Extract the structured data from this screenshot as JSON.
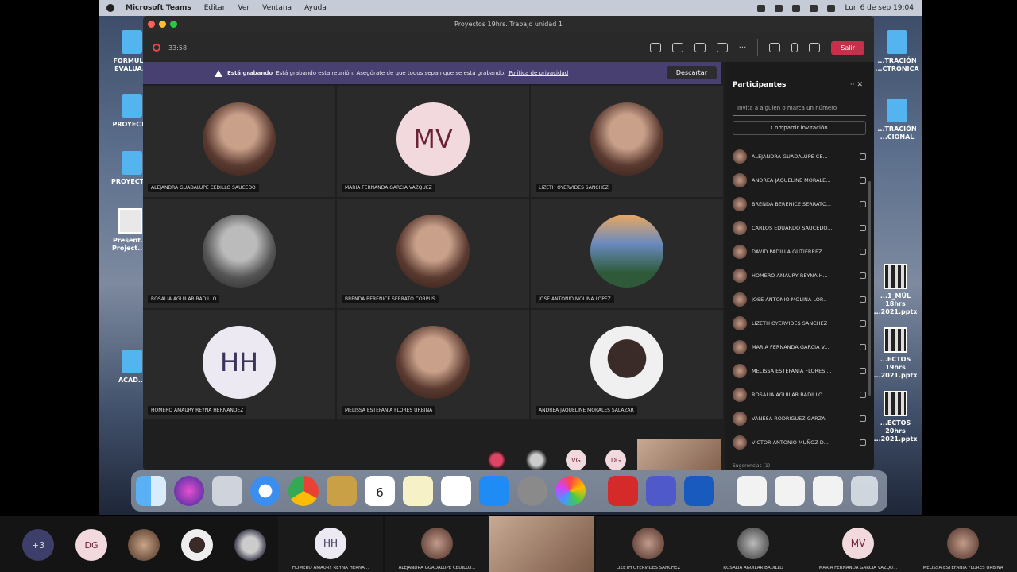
{
  "menubar": {
    "app": "Microsoft Teams",
    "items": [
      "Editar",
      "Ver",
      "Ventana",
      "Ayuda"
    ],
    "clock": "Lun 6 de sep  19:04"
  },
  "desktop_icons": [
    {
      "label": "FORMUL... EVALUA..."
    },
    {
      "label": "PROYECT..."
    },
    {
      "label": "PROYECTI..."
    },
    {
      "label": "Present... Project...s"
    },
    {
      "label": "ACAD..."
    },
    {
      "label": "...TRACIÓN ...CTRÓNICA"
    },
    {
      "label": "...TRACIÓN ...CIONAL"
    },
    {
      "label": "...1_MÜL 18hrs ...2021.pptx"
    },
    {
      "label": "...ECTOS 19hrs ...2021.pptx"
    },
    {
      "label": "...ECTOS 20hrs ...2021.pptx"
    }
  ],
  "window": {
    "title": "Proyectos 19hrs. Trabajo unidad 1"
  },
  "toolbar": {
    "timer": "33:58",
    "leave_label": "Salir"
  },
  "banner": {
    "bold": "Está grabando",
    "text": "Está grabando esta reunión. Asegúrate de que todos sepan que se está grabando.",
    "link": "Política de privacidad",
    "dismiss": "Descartar"
  },
  "tiles": [
    {
      "name": "ALEJANDRA GUADALUPE CEDILLO SAUCEDO",
      "initials": ""
    },
    {
      "name": "MARIA FERNANDA GARCIA VAZQUEZ",
      "initials": "MV"
    },
    {
      "name": "LIZETH OYERVIDES SANCHEZ",
      "initials": ""
    },
    {
      "name": "ROSALIA AGUILAR BADILLO",
      "initials": ""
    },
    {
      "name": "BRENDA BERENICE SERRATO CORPUS",
      "initials": ""
    },
    {
      "name": "JOSE ANTONIO MOLINA LOPEZ",
      "initials": ""
    },
    {
      "name": "HOMERO AMAURY REYNA HERNANDEZ",
      "initials": "HH"
    },
    {
      "name": "MELISSA ESTEFANIA FLORES URBINA",
      "initials": ""
    },
    {
      "name": "ANDREA JAQUELINE MORALES SALAZAR",
      "initials": ""
    }
  ],
  "overflow": {
    "initials_1": "VG",
    "initials_2": "DG"
  },
  "panel": {
    "title": "Participantes",
    "invite_placeholder": "Invita a alguien o marca un número",
    "share": "Compartir invitación",
    "participants": [
      "ALEJANDRA GUADALUPE CE...",
      "ANDREA JAQUELINE MORALE...",
      "BRENDA BERENICE SERRATO...",
      "CARLOS EDUARDO SAUCEDO...",
      "DAVID PADILLA GUTIERREZ",
      "HOMERO AMAURY REYNA H...",
      "JOSE ANTONIO MOLINA LOP...",
      "LIZETH OYERVIDES SANCHEZ",
      "MARIA FERNANDA GARCIA V...",
      "MELISSA ESTEFANIA FLORES ...",
      "ROSALIA AGUILAR BADILLO",
      "VANESA RODRIGUEZ GARZA",
      "VICTOR ANTONIO MUÑOZ D..."
    ],
    "suggestions": "Sugerencias (1)"
  },
  "dock": {
    "calendar_day": "6",
    "calendar_month": "SEP"
  },
  "outer_strip": {
    "more": "+3",
    "initials": "DG",
    "tiles": [
      {
        "label": "HOMERO AMAURY REYNA HERNA...",
        "initials": "HH"
      },
      {
        "label": "ALEJANDRA GUADALUPE CEDILLO...",
        "initials": ""
      },
      {
        "label": "",
        "initials": ""
      },
      {
        "label": "LIZETH OYERVIDES SANCHEZ",
        "initials": ""
      },
      {
        "label": "ROSALIA AGUILAR BADILLO",
        "initials": ""
      },
      {
        "label": "MARIA FERNANDA GARCIA VAZQU...",
        "initials": "MV"
      },
      {
        "label": "MELISSA ESTEFANIA FLORES URBINA",
        "initials": ""
      }
    ]
  }
}
